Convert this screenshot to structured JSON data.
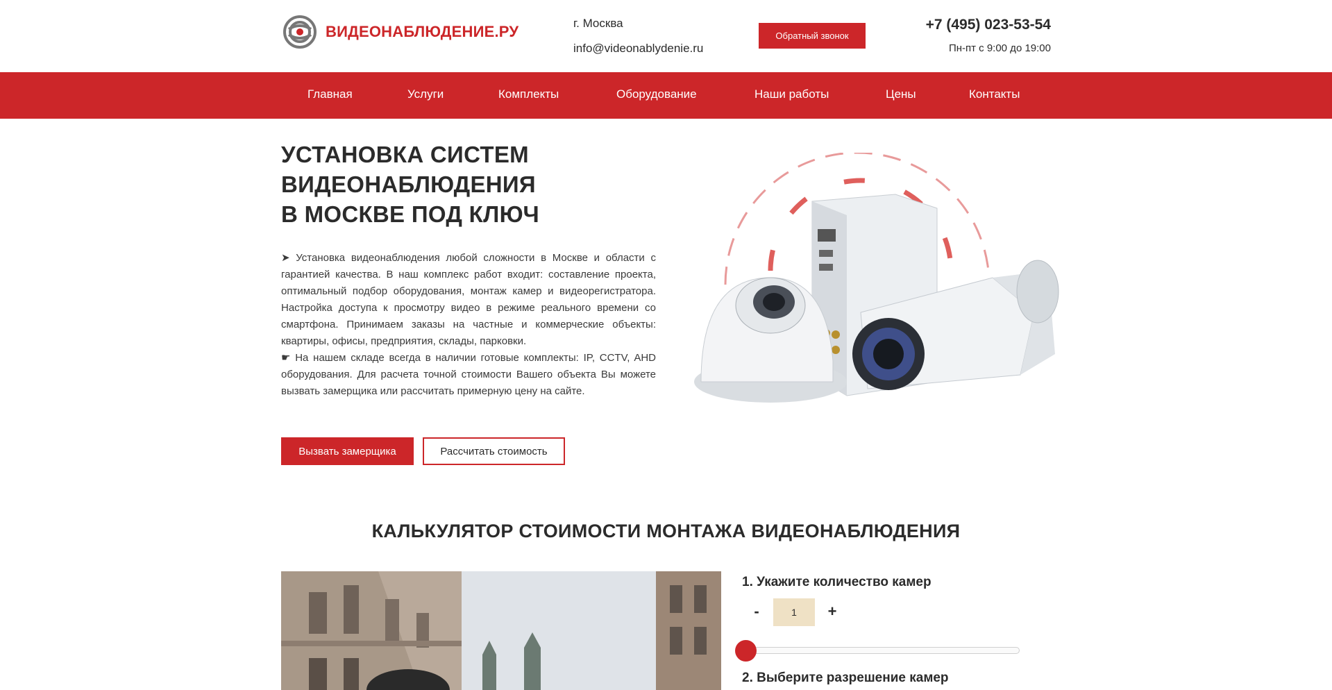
{
  "header": {
    "brand": "ВИДЕОНАБЛЮДЕНИЕ.РУ",
    "city": "г. Москва",
    "email": "info@videonablydenie.ru",
    "callback_label": "Обратный звонок",
    "phone": "+7 (495) 023-53-54",
    "hours": "Пн-пт с 9:00 до 19:00"
  },
  "nav": {
    "items": [
      {
        "label": "Главная"
      },
      {
        "label": "Услуги"
      },
      {
        "label": "Комплекты"
      },
      {
        "label": "Оборудование"
      },
      {
        "label": "Наши работы"
      },
      {
        "label": "Цены"
      },
      {
        "label": "Контакты"
      }
    ]
  },
  "hero": {
    "title_lines": [
      "УСТАНОВКА СИСТЕМ",
      "ВИДЕОНАБЛЮДЕНИЯ",
      "В МОСКВЕ ПОД КЛЮЧ"
    ],
    "paragraph1": "➤ Установка видеонаблюдения любой сложности в Москве и области с гарантией качества. В наш комплекс работ входит: составление проекта, оптимальный подбор оборудования, монтаж камер и видеорегистратора. Настройка доступа к просмотру видео в режиме реального времени со смартфона. Принимаем заказы на частные и коммерческие объекты: квартиры, офисы, предприятия, склады, парковки.",
    "paragraph2": "☛ На нашем складе всегда в наличии готовые комплекты: IP, CCTV, AHD оборудования. Для расчета точной стоимости Вашего объекта Вы можете вызвать замерщика или рассчитать примерную цену на сайте.",
    "btn_primary": "Вызвать замерщика",
    "btn_secondary": "Рассчитать стоимость"
  },
  "calculator": {
    "title": "КАЛЬКУЛЯТОР СТОИМОСТИ МОНТАЖА ВИДЕОНАБЛЮДЕНИЯ",
    "step1_label": "1. Укажите количество камер",
    "minus_label": "-",
    "plus_label": "+",
    "quantity": "1",
    "slider_value": 1,
    "step2_label": "2. Выберите разрешение камер"
  },
  "colors": {
    "accent": "#cc2629",
    "text": "#2b2b2b",
    "qty_bg": "#efe1c5"
  }
}
